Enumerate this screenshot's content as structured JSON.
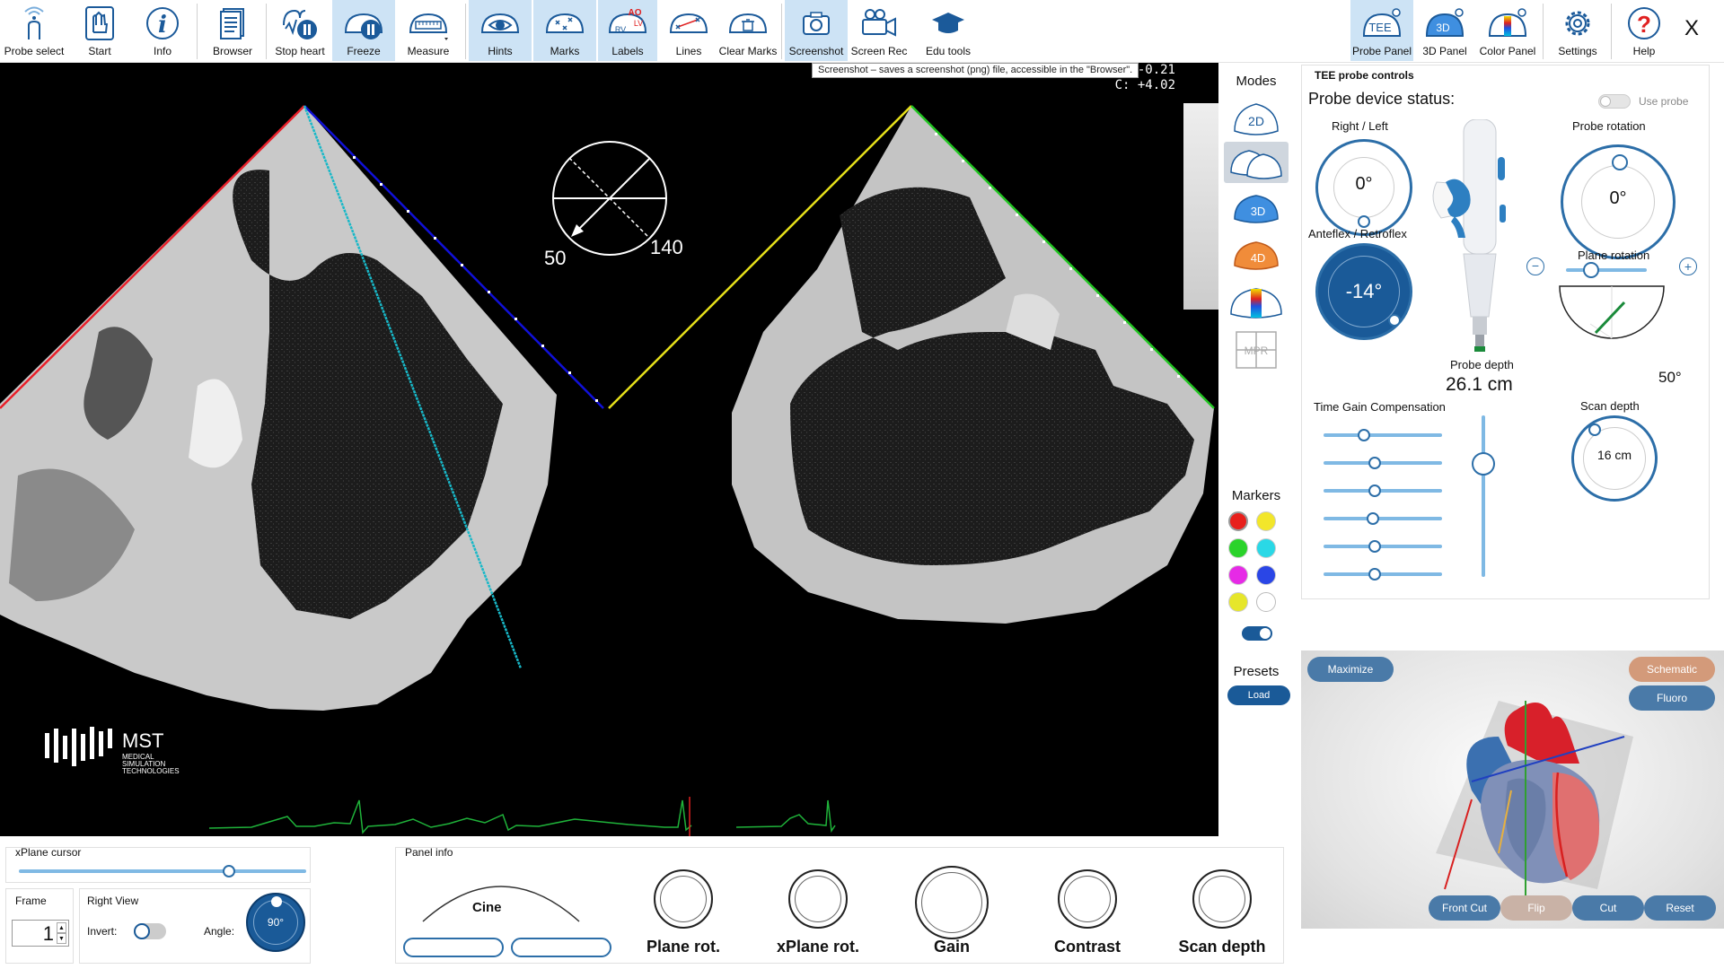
{
  "toolbar": {
    "items": [
      {
        "label": "Probe select",
        "icon": "probe-select-icon"
      },
      {
        "label": "Start",
        "icon": "start-hand-icon"
      },
      {
        "label": "Info",
        "icon": "info-icon"
      },
      {
        "label": "Browser",
        "icon": "browser-icon"
      },
      {
        "label": "Stop heart",
        "icon": "stop-heart-icon"
      },
      {
        "label": "Freeze",
        "icon": "freeze-icon"
      },
      {
        "label": "Measure",
        "icon": "measure-icon"
      },
      {
        "label": "Hints",
        "icon": "hints-eye-icon"
      },
      {
        "label": "Marks",
        "icon": "marks-icon"
      },
      {
        "label": "Labels",
        "icon": "labels-icon"
      },
      {
        "label": "Lines",
        "icon": "lines-icon"
      },
      {
        "label": "Clear Marks",
        "icon": "clear-marks-icon"
      },
      {
        "label": "Screenshot",
        "icon": "camera-icon"
      },
      {
        "label": "Screen Rec",
        "icon": "video-camera-icon"
      },
      {
        "label": "Edu tools",
        "icon": "graduation-cap-icon"
      },
      {
        "label": "Probe Panel",
        "icon": "tee-probe-icon"
      },
      {
        "label": "3D Panel",
        "icon": "3d-panel-icon"
      },
      {
        "label": "Color Panel",
        "icon": "color-panel-icon"
      },
      {
        "label": "Settings",
        "icon": "gear-icon"
      },
      {
        "label": "Help",
        "icon": "help-icon"
      }
    ],
    "labels_icon_text": {
      "ao": "AO",
      "lv": "LV",
      "rv": "RV"
    },
    "probe_icon_text": "TEE",
    "panel3d_icon_text": "3D",
    "close_label": "X",
    "tooltip": "Screenshot – saves a screenshot (png) file, accessible in the \"Browser\"."
  },
  "viewer": {
    "readout_1": "-0.21",
    "readout_2": "C: +4.02",
    "angle_left": "50",
    "angle_right": "140",
    "logo_text": "MST",
    "logo_sub": [
      "MEDICAL",
      "SIMULATION",
      "TECHNOLOGIES"
    ],
    "colors": {
      "red": "#e8202a",
      "blue": "#1010d8",
      "yellow": "#e6e01a",
      "green": "#22c522",
      "cyan": "#18b8c8",
      "ecg": "#1fb33a"
    }
  },
  "modes": {
    "title": "Modes",
    "items": [
      {
        "label": "2D",
        "icon": "2d-mode-icon"
      },
      {
        "label": "",
        "icon": "xplane-mode-icon",
        "selected": true
      },
      {
        "label": "3D",
        "icon": "3d-mode-icon"
      },
      {
        "label": "4D",
        "icon": "4d-mode-icon"
      },
      {
        "label": "",
        "icon": "color-doppler-mode-icon"
      },
      {
        "label": "MPR",
        "icon": "mpr-mode-icon"
      }
    ],
    "markers_title": "Markers",
    "marker_colors": [
      "#e8201c",
      "#f2e62a",
      "#2ad32a",
      "#2ad8e6",
      "#e62ae6",
      "#2a46e6",
      "#e6e62a",
      "#ffffff"
    ],
    "presets_title": "Presets",
    "load_label": "Load"
  },
  "probe_panel": {
    "title": "TEE probe controls",
    "status_label": "Probe device status:",
    "use_probe_label": "Use probe",
    "right_left_label": "Right / Left",
    "right_left_value": "0°",
    "probe_rotation_label": "Probe rotation",
    "probe_rotation_value": "0°",
    "anteflex_label": "Anteflex / Retroflex",
    "anteflex_value": "-14°",
    "plane_rotation_label": "Plane rotation",
    "plane_rotation_value": "50°",
    "minus_label": "−",
    "plus_label": "+",
    "probe_depth_label": "Probe depth",
    "probe_depth_value": "26.1 cm",
    "tgc_label": "Time Gain Compensation",
    "tgc_levels": [
      0.34,
      0.43,
      0.43,
      0.42,
      0.43,
      0.43
    ],
    "gain_level": 0.3,
    "scan_depth_label": "Scan depth",
    "scan_depth_value": "16 cm"
  },
  "view3d": {
    "maximize_label": "Maximize",
    "schematic_label": "Schematic",
    "fluoro_label": "Fluoro",
    "front_cut_label": "Front Cut",
    "flip_label": "Flip",
    "cut_label": "Cut",
    "reset_label": "Reset"
  },
  "bottom": {
    "xplane_cursor_label": "xPlane cursor",
    "xplane_cursor_level": 0.73,
    "frame_label": "Frame",
    "frame_value": "1",
    "right_view_label": "Right View",
    "invert_label": "Invert:",
    "angle_label": "Angle:",
    "angle_value": "90°",
    "panel_info_label": "Panel info",
    "cine_label": "Cine",
    "knobs": [
      "Plane rot.",
      "xPlane rot.",
      "Gain",
      "Contrast",
      "Scan depth"
    ]
  }
}
